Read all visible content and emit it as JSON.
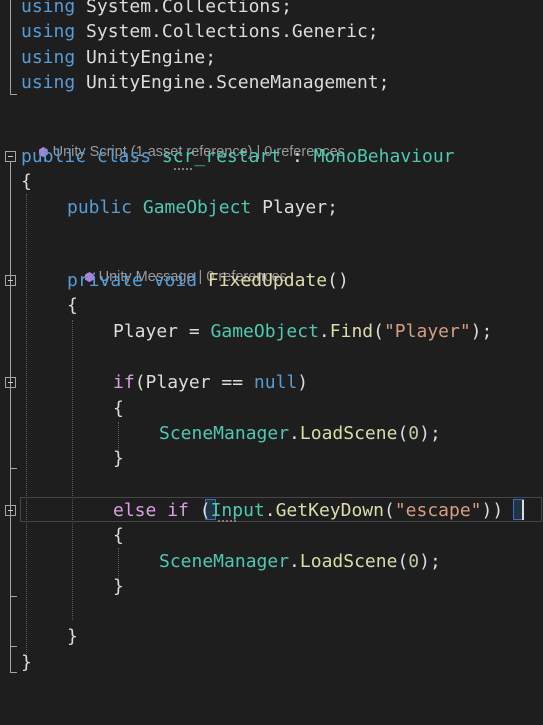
{
  "editor": {
    "lines": {
      "using1_kw": "using",
      "using1_ns": " System.Collections;",
      "using2_kw": "using",
      "using2_ns": " System.Collections.Generic;",
      "using3_kw": "using",
      "using3_ns": " UnityEngine;",
      "using4_kw": "using",
      "using4_ns": " UnityEngine.SceneManagement;",
      "class_public": "public",
      "class_kw": " class ",
      "class_name": "scr_restart",
      "class_colon": " : ",
      "class_base": "MonoBehaviour",
      "open_brace": "{",
      "field_public": "public",
      "field_type": "GameObject",
      "field_name": " Player;",
      "method_private": "private",
      "method_void": " void ",
      "method_name": "FixedUpdate",
      "method_parens": "()",
      "method_open": "{",
      "assign_lhs": "Player = ",
      "assign_type": "GameObject",
      "assign_dot": ".",
      "assign_find": "Find",
      "assign_open": "(",
      "assign_str": "\"Player\"",
      "assign_close": ");",
      "if_kw": "if",
      "if_cond": "(Player == ",
      "if_null": "null",
      "if_close": ")",
      "if_open": "{",
      "load1_type": "SceneManager",
      "load1_dot": ".",
      "load1_meth": "LoadScene",
      "load1_open": "(",
      "load1_num": "0",
      "load1_close": ");",
      "if_end": "}",
      "else_kw": "else",
      "else_if": " if",
      "else_sp": " ",
      "else_paren": "(",
      "else_type": "Input",
      "else_dot": ".",
      "else_meth": "GetKeyDown",
      "else_open": "(",
      "else_str": "\"escape\"",
      "else_close1": ")",
      "else_close2": ")",
      "else_open_brace": "{",
      "load2_type": "SceneManager",
      "load2_dot": ".",
      "load2_meth": "LoadScene",
      "load2_open": "(",
      "load2_num": "0",
      "load2_close": ");",
      "else_end": "}",
      "method_end": "}",
      "class_end": "}"
    },
    "codelens": {
      "class": "Unity Script (1 asset reference) | 0 references",
      "method": "Unity Message | 0 references"
    },
    "icons": {
      "codelens_icon": "unity-cube-icon",
      "fold_icon": "collapse-minus-icon"
    },
    "colors": {
      "background": "#1e1e1e",
      "keyword": "#569cd6",
      "control_keyword": "#d8a0df",
      "type": "#4ec9b0",
      "method": "#dcdcaa",
      "string": "#d69d85",
      "number": "#b5cea8"
    }
  }
}
